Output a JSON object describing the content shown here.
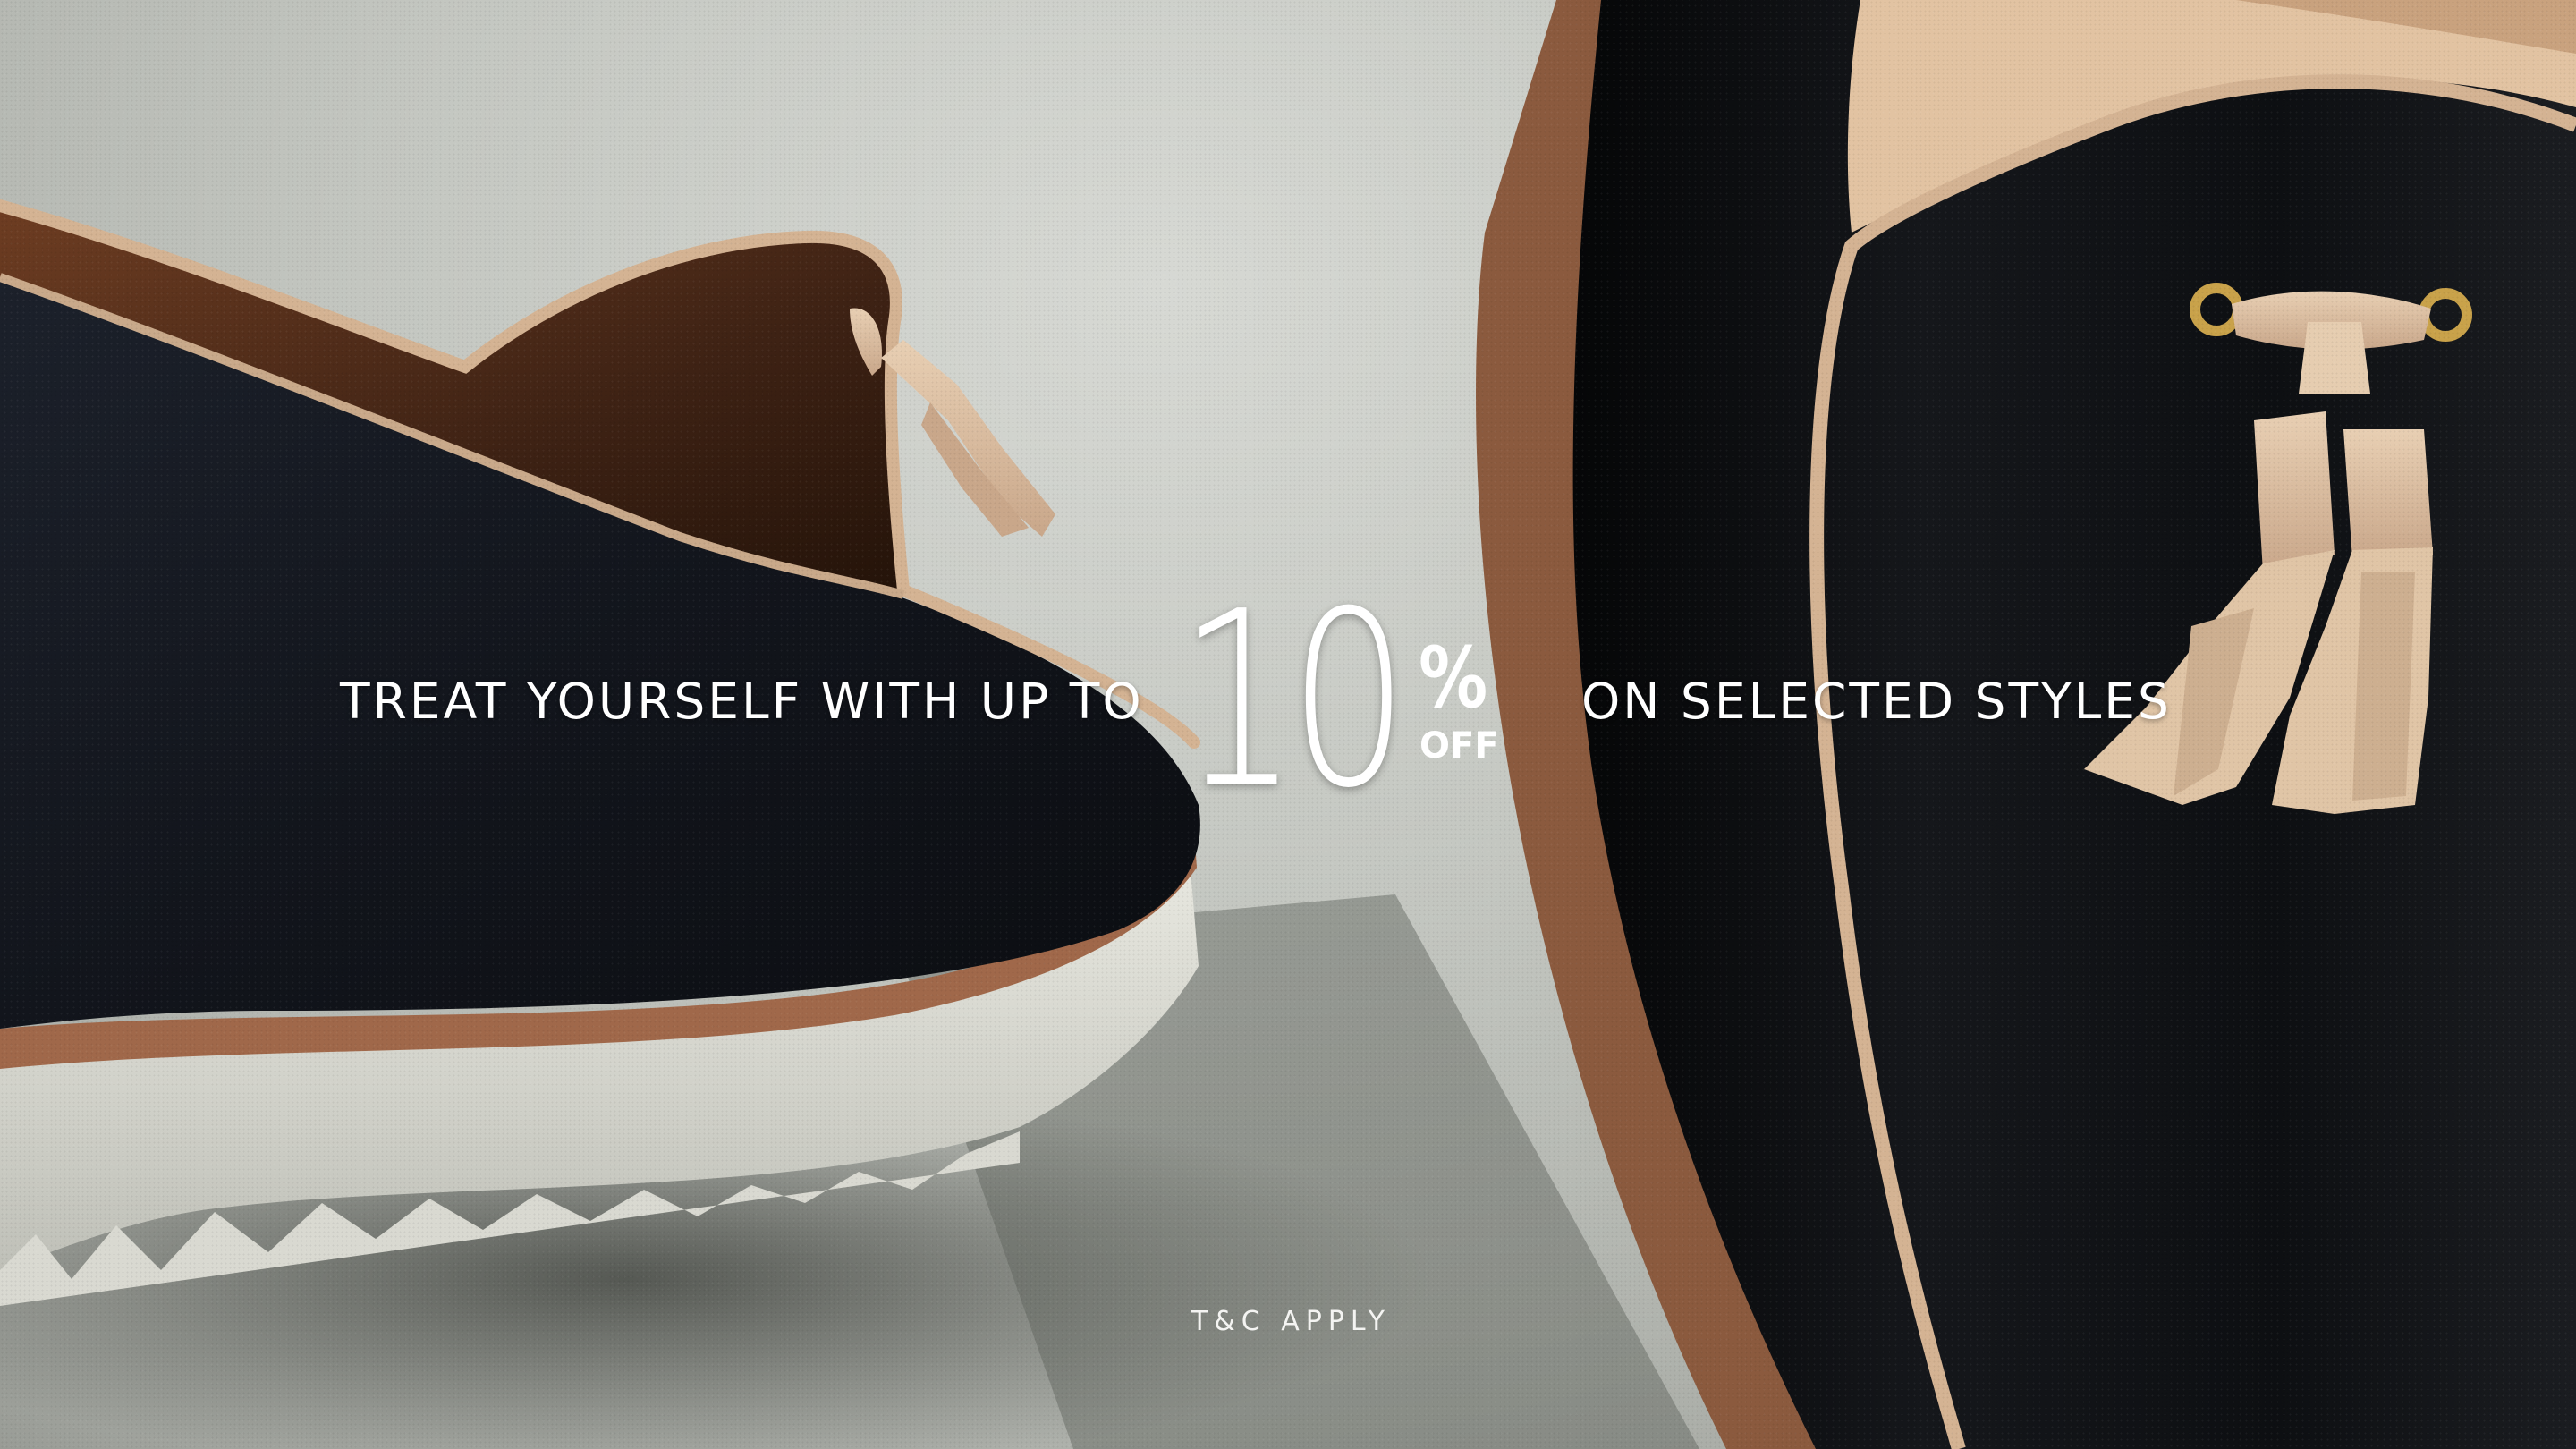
{
  "banner": {
    "lead_text": "TREAT YOURSELF WITH UP TO",
    "discount_number": "10",
    "percent_sign": "%",
    "off_label": "OFF",
    "tail_text": "ON SELECTED STYLES",
    "terms": "T&C APPLY"
  },
  "colors": {
    "text": "#ffffff",
    "backdrop": "#c3c6c0",
    "shoe_leather": "#14161c",
    "piping": "#d4b393",
    "sole": "#e2e2da",
    "welt": "#a0684a",
    "brass": "#c9a24a"
  },
  "imagery": {
    "left_object": "black-tassel-loafer-heel",
    "right_object": "black-tassel-loafer-vamp-closeup"
  }
}
